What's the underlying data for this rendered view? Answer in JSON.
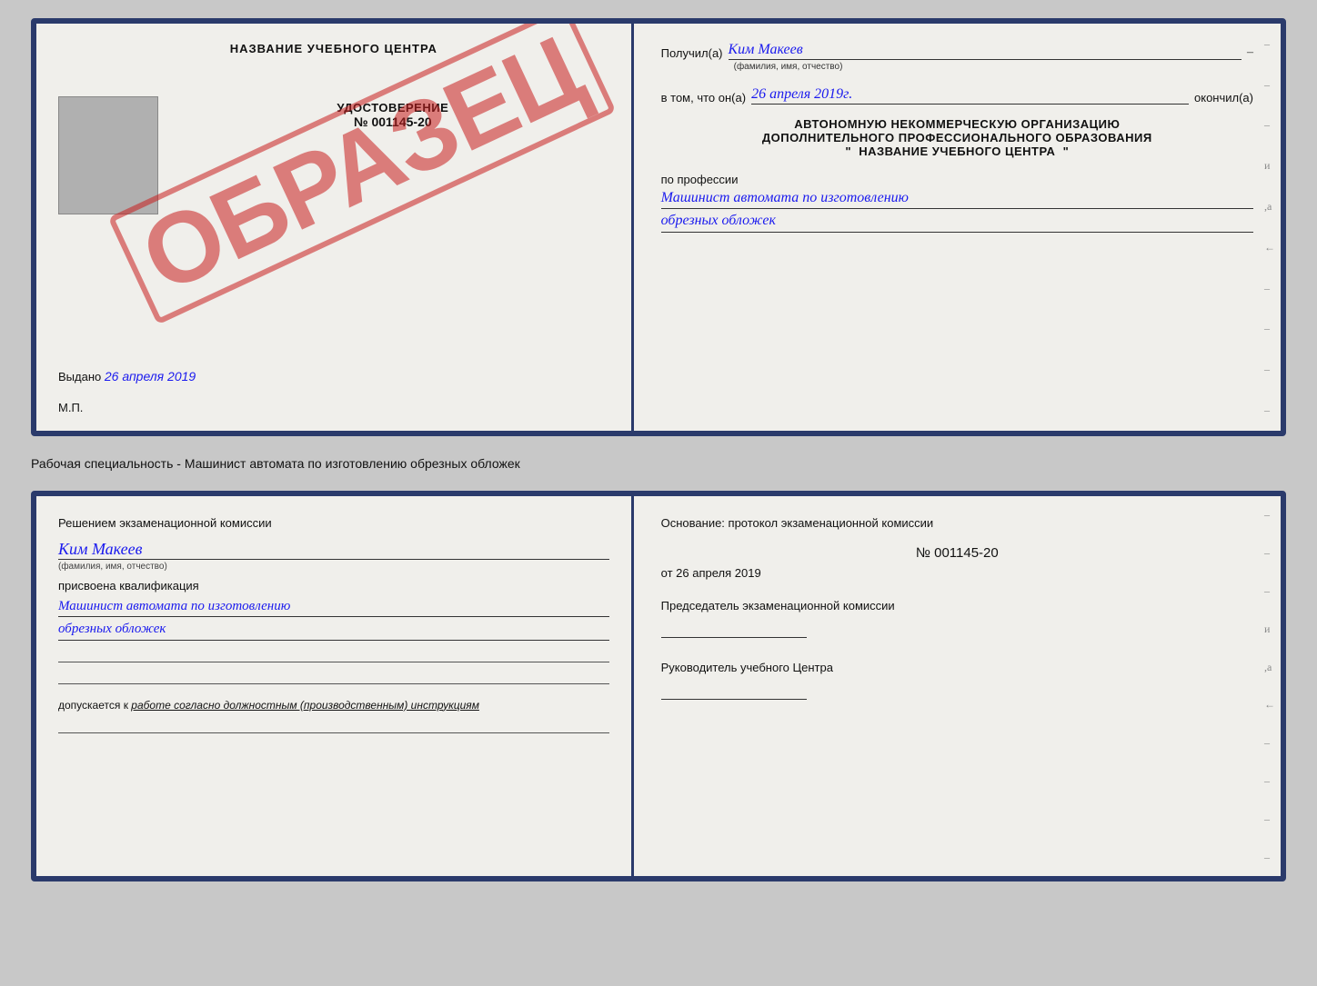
{
  "top_doc": {
    "left": {
      "school_name": "НАЗВАНИЕ УЧЕБНОГО ЦЕНТРА",
      "udostoverenie_label": "УДОСТОВЕРЕНИЕ",
      "number": "№ 001145-20",
      "issued_label": "Выдано",
      "issued_date": "26 апреля 2019",
      "mp_label": "М.П.",
      "stamp_text": "ОБРАЗЕЦ"
    },
    "right": {
      "poluchil_label": "Получил(a)",
      "recipient_name": "Ким Макеев",
      "fio_subtitle": "(фамилия, имя, отчество)",
      "v_tom_label": "в том, что он(a)",
      "completion_date": "26 апреля 2019г.",
      "okonchil_label": "окончил(а)",
      "org_line1": "АВТОНОМНУЮ НЕКОММЕРЧЕСКУЮ ОРГАНИЗАЦИЮ",
      "org_line2": "ДОПОЛНИТЕЛЬНОГО ПРОФЕССИОНАЛЬНОГО ОБРАЗОВАНИЯ",
      "org_quote1": "\"",
      "org_name": "НАЗВАНИЕ УЧЕБНОГО ЦЕНТРА",
      "org_quote2": "\"",
      "po_professii_label": "по профессии",
      "profession_line1": "Машинист автомата по изготовлению",
      "profession_line2": "обрезных обложек"
    }
  },
  "between_label": "Рабочая специальность - Машинист автомата по изготовлению обрезных обложек",
  "bottom_doc": {
    "left": {
      "resheniem_label": "Решением экзаменационной комиссии",
      "recipient_name": "Ким Макеев",
      "fio_subtitle": "(фамилия, имя, отчество)",
      "prisvoena_label": "присвоена квалификация",
      "profession_line1": "Машинист автомата по изготовлению",
      "profession_line2": "обрезных обложек",
      "dopuskaetsya_label": "допускается к",
      "dopuskaetsya_value": "работе согласно должностным (производственным) инструкциям"
    },
    "right": {
      "osnov_label": "Основание: протокол экзаменационной комиссии",
      "number": "№ 001145-20",
      "ot_label": "от",
      "date": "26 апреля 2019",
      "predsedatel_label": "Председатель экзаменационной комиссии",
      "rukovoditel_label": "Руководитель учебного Центра"
    }
  },
  "dashes": [
    "-",
    "-",
    "-",
    "и",
    ",а",
    "←",
    "-",
    "-",
    "-",
    "-"
  ],
  "bottom_dashes": [
    "-",
    "-",
    "-",
    "и",
    ",а",
    "←",
    "-",
    "-",
    "-",
    "-"
  ]
}
